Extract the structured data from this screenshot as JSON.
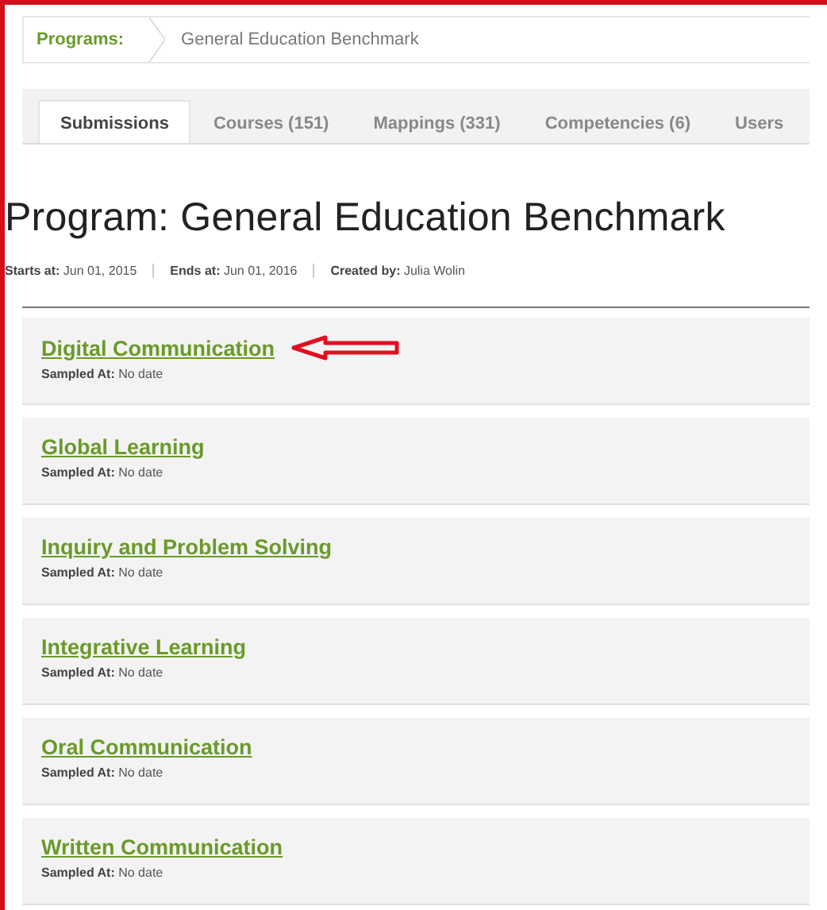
{
  "breadcrumb": {
    "parent": "Programs:",
    "current": "General Education Benchmark"
  },
  "tabs": [
    {
      "label": "Submissions",
      "selected": true
    },
    {
      "label": "Courses (151)",
      "selected": false
    },
    {
      "label": "Mappings (331)",
      "selected": false
    },
    {
      "label": "Competencies (6)",
      "selected": false
    },
    {
      "label": "Users",
      "selected": false
    }
  ],
  "title": "Program: General Education Benchmark",
  "meta": [
    {
      "label": "Starts at:",
      "value": "Jun 01, 2015"
    },
    {
      "label": "Ends at:",
      "value": "Jun 01, 2016"
    },
    {
      "label": "Created by:",
      "value": "Julia Wolin"
    }
  ],
  "competencies": [
    {
      "name": "Digital Communication",
      "sampled_label": "Sampled At:",
      "sampled_value": "No date",
      "highlighted": true
    },
    {
      "name": "Global Learning",
      "sampled_label": "Sampled At:",
      "sampled_value": "No date",
      "highlighted": false
    },
    {
      "name": "Inquiry and Problem Solving",
      "sampled_label": "Sampled At:",
      "sampled_value": "No date",
      "highlighted": false
    },
    {
      "name": "Integrative Learning",
      "sampled_label": "Sampled At:",
      "sampled_value": "No date",
      "highlighted": false
    },
    {
      "name": "Oral Communication",
      "sampled_label": "Sampled At:",
      "sampled_value": "No date",
      "highlighted": false
    },
    {
      "name": "Written Communication",
      "sampled_label": "Sampled At:",
      "sampled_value": "No date",
      "highlighted": false
    }
  ]
}
